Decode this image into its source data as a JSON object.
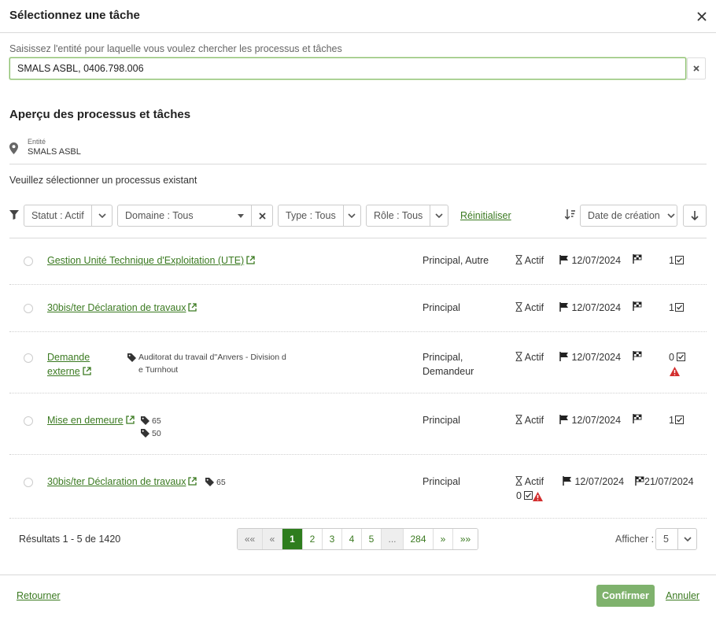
{
  "modal": {
    "title": "Sélectionnez une tâche"
  },
  "search": {
    "label": "Saisissez l'entité pour laquelle vous voulez chercher les processus et tâches",
    "value": "SMALS ASBL, 0406.798.006"
  },
  "overview": {
    "title": "Aperçu des processus et tâches",
    "entity_caption": "Entité",
    "entity_name": "SMALS ASBL",
    "instruction": "Veuillez sélectionner un processus existant"
  },
  "filters": {
    "statut": "Statut : Actif",
    "domaine": "Domaine : Tous",
    "type": "Type : Tous",
    "role": "Rôle : Tous",
    "reset": "Réinitialiser",
    "sort": "Date de création"
  },
  "rows": [
    {
      "title": "Gestion Unité Technique d'Exploitation (UTE)",
      "role": "Principal, Autre",
      "status": "Actif",
      "start_date": "12/07/2024",
      "count": "1"
    },
    {
      "title": "30bis/ter Déclaration de travaux",
      "role": "Principal",
      "status": "Actif",
      "start_date": "12/07/2024",
      "count": "1"
    },
    {
      "title_line1": "Demande",
      "title_line2": "externe",
      "tag_line1": "Auditorat du travail d''Anvers - Division d",
      "tag_line2": "e Turnhout",
      "role_line1": "Principal,",
      "role_line2": "Demandeur",
      "status": "Actif",
      "start_date": "12/07/2024",
      "count": "0"
    },
    {
      "title": "Mise en demeure",
      "tags": [
        "65",
        "50"
      ],
      "role": "Principal",
      "status": "Actif",
      "start_date": "12/07/2024",
      "count": "1"
    },
    {
      "title": "30bis/ter Déclaration de travaux",
      "tags": [
        "65"
      ],
      "role": "Principal",
      "status": "Actif",
      "start_date": "12/07/2024",
      "end_date": "21/07/2024",
      "count": "0"
    }
  ],
  "pagination": {
    "results_text": "Résultats 1 - 5 de 1420",
    "first": "««",
    "prev": "«",
    "pages": [
      "1",
      "2",
      "3",
      "4",
      "5"
    ],
    "ellipsis": "...",
    "last_page": "284",
    "next": "»",
    "last": "»»",
    "current_page": 1,
    "show_label": "Afficher :",
    "page_size": "5"
  },
  "footer": {
    "back": "Retourner",
    "confirm": "Confirmer",
    "cancel": "Annuler"
  },
  "colors": {
    "accent": "#3b7a21",
    "active_page": "#2e7d1e",
    "confirm_button": "#7fb26d",
    "warning": "#d32f2f"
  }
}
